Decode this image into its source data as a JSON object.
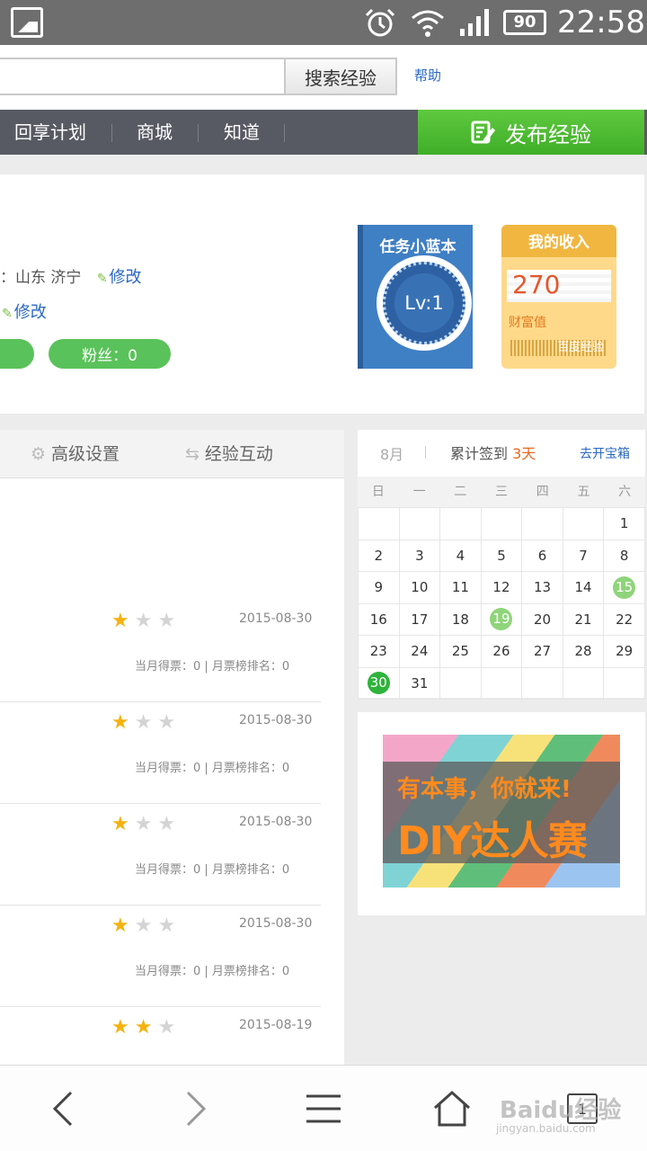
{
  "status_bar": {
    "battery": "90",
    "time": "22:58"
  },
  "search": {
    "button_label": "搜索经验",
    "help_label": "帮助"
  },
  "nav": {
    "items": [
      "回享计划",
      "商城",
      "知道"
    ],
    "publish_label": "发布经验"
  },
  "profile": {
    "location": "：山东 济宁",
    "edit_label": "修改",
    "edit_label_2": "修改",
    "fans_label": "粉丝：0"
  },
  "task_card": {
    "title": "任务小蓝本",
    "level": "Lv:1"
  },
  "income_card": {
    "title": "我的收入",
    "value": "270",
    "label": "财富值",
    "brand": "百度经验"
  },
  "tabs": [
    {
      "label": "高级设置",
      "icon": "gear-icon"
    },
    {
      "label": "经验互动",
      "icon": "swap-icon"
    }
  ],
  "experiences": [
    {
      "stars": 1,
      "date": "2015-08-30",
      "votes": "当月得票：0 | 月票榜排名：0"
    },
    {
      "stars": 1,
      "date": "2015-08-30",
      "votes": "当月得票：0 | 月票榜排名：0"
    },
    {
      "stars": 1,
      "date": "2015-08-30",
      "votes": "当月得票：0 | 月票榜排名：0"
    },
    {
      "stars": 1,
      "date": "2015-08-30",
      "votes": "当月得票：0 | 月票榜排名：0"
    },
    {
      "stars": 2,
      "date": "2015-08-19",
      "votes": ""
    }
  ],
  "calendar": {
    "month": "8月",
    "total_prefix": "累计签到",
    "total_days": "3天",
    "open_chest": "去开宝箱",
    "weekdays": [
      "日",
      "一",
      "二",
      "三",
      "四",
      "五",
      "六"
    ],
    "weeks": [
      [
        "",
        "",
        "",
        "",
        "",
        "",
        "1"
      ],
      [
        "2",
        "3",
        "4",
        "5",
        "6",
        "7",
        "8"
      ],
      [
        "9",
        "10",
        "11",
        "12",
        "13",
        "14",
        "15"
      ],
      [
        "16",
        "17",
        "18",
        "19",
        "20",
        "21",
        "22"
      ],
      [
        "23",
        "24",
        "25",
        "26",
        "27",
        "28",
        "29"
      ],
      [
        "30",
        "31",
        "",
        "",
        "",
        "",
        ""
      ]
    ],
    "signed_light": [
      "15",
      "19"
    ],
    "signed_dark": [
      "30"
    ]
  },
  "ad": {
    "line1": "有本事，你就来!",
    "line2": "DIY达人赛"
  },
  "bottom_nav": {
    "tab_count": "1"
  },
  "watermark": {
    "brand": "Baidu经验",
    "url": "jingyan.baidu.com"
  },
  "colors": {
    "accent_green": "#4fbd34",
    "link_blue": "#2a68c2",
    "nav_gray": "#585a63",
    "highlight_orange": "#e8681c"
  }
}
